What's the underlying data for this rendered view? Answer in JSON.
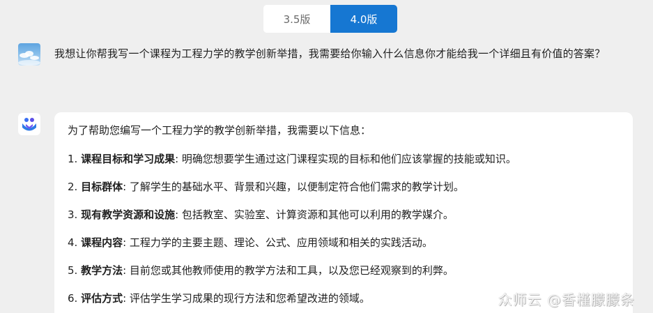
{
  "version_toggle": {
    "options": [
      {
        "label": "3.5版",
        "active": false
      },
      {
        "label": "4.0版",
        "active": true
      }
    ],
    "active_color": "#1677d2"
  },
  "user_message": {
    "avatar": "sky-photo-avatar",
    "text": "我想让你帮我写一个课程为工程力学的教学创新举措，我需要给你输入什么信息你才能给我一个详细且有价值的答案？"
  },
  "assistant_message": {
    "avatar": "bot-logo-icon",
    "intro": "为了帮助您编写一个工程力学的教学创新举措，我需要以下信息：",
    "items": [
      {
        "num": "1. ",
        "title": "课程目标和学习成果",
        "desc": ": 明确您想要学生通过这门课程实现的目标和他们应该掌握的技能或知识。"
      },
      {
        "num": "2. ",
        "title": "目标群体",
        "desc": ": 了解学生的基础水平、背景和兴趣，以便制定符合他们需求的教学计划。"
      },
      {
        "num": "3. ",
        "title": "现有教学资源和设施",
        "desc": ": 包括教室、实验室、计算资源和其他可以利用的教学媒介。"
      },
      {
        "num": "4. ",
        "title": "课程内容",
        "desc": ": 工程力学的主要主题、理论、公式、应用领域和相关的实践活动。"
      },
      {
        "num": "5. ",
        "title": "教学方法",
        "desc": ": 目前您或其他教师使用的教学方法和工具，以及您已经观察到的利弊。"
      },
      {
        "num": "6. ",
        "title": "评估方式",
        "desc": ": 评估学生学习成果的现行方法和您希望改进的领域。"
      }
    ]
  },
  "watermark": {
    "text": "众师云 @香槿朦朦条"
  }
}
